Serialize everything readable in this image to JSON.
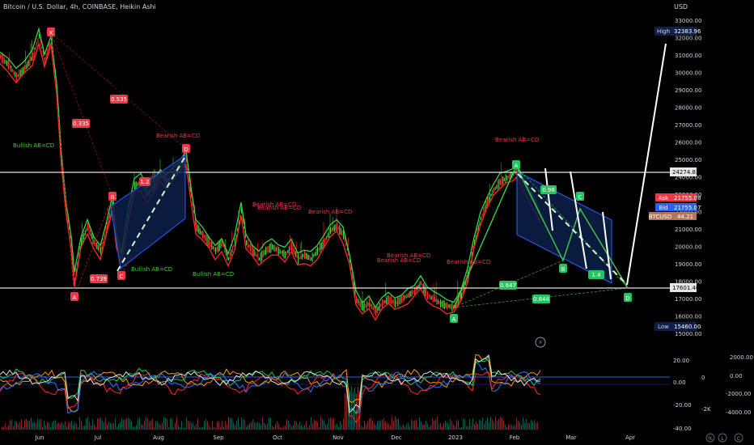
{
  "header": {
    "title": "Bitcoin / U.S. Dollar, 4h, COINBASE, Heikin Ashi",
    "currency": "USD"
  },
  "price_axis": {
    "ticks": [
      "33000.00",
      "32000.00",
      "31000.00",
      "30000.00",
      "29000.00",
      "28000.00",
      "27000.00",
      "26000.00",
      "25000.00",
      "24000.00",
      "23000.00",
      "22000.00",
      "21000.00",
      "20000.00",
      "19000.00",
      "18000.00",
      "17000.00",
      "16000.00",
      "15000.00"
    ],
    "high_label": "High",
    "high_value": "32383.96",
    "level_upper": "24274.83",
    "ask_label": "Ask",
    "ask_value": "21755.08",
    "bid_label": "Bid",
    "bid_value": "21755.07",
    "symbol_label": "BTCUSD",
    "spread_value": "44.21",
    "level_lower": "17601.40",
    "low_label": "Low",
    "low_value": "15460.00",
    "colors": {
      "ask": "#f23645",
      "bid": "#2962ff",
      "symbol": "#b2775a",
      "range": "#0d1f4a"
    }
  },
  "time_axis": {
    "ticks": [
      "Jun",
      "Jul",
      "Aug",
      "Sep",
      "Oct",
      "Nov",
      "Dec",
      "2023",
      "Feb",
      "Mar",
      "Apr"
    ]
  },
  "annotations": {
    "point_labels": [
      "X",
      "A",
      "B",
      "C",
      "D",
      "A",
      "B",
      "C",
      "D"
    ],
    "ratio_labels": [
      "0.335",
      "0.535",
      "0.739",
      "1.2",
      "0.96",
      "0.647",
      "0.844",
      "1.4"
    ],
    "pattern_labels": [
      "Bullish AB=CD",
      "Bearish AB=CD",
      "Bullish AB=CD",
      "Bullish AB=CD",
      "Bearish AB=CD",
      "Bearish AB=CD",
      "Bearish AB=CD",
      "Bearish AB=CD",
      "Bearish AB=CD",
      "Bearish AB=CD",
      "Bearish AB=CD"
    ]
  },
  "oscillator": {
    "left_ticks": [
      "20.00",
      "0.00",
      "-20.00",
      "-40.00"
    ],
    "mid_ticks": [
      "0",
      "-2K"
    ],
    "right_ticks": [
      "2000.00",
      "0.00",
      "-2000.00",
      "-4000.00"
    ]
  },
  "icons": [
    "lightning-icon",
    "percent-icon",
    "log-icon",
    "auto-icon"
  ],
  "icon_letters": {
    "percent": "%",
    "log": "L",
    "auto": "C"
  }
}
